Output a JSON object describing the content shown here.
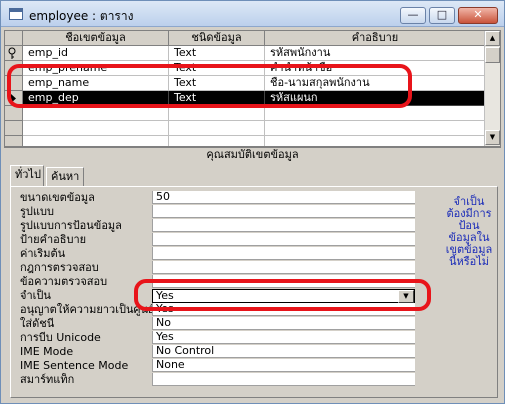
{
  "window": {
    "title": "employee : ตาราง",
    "minimize": "—",
    "maximize": "□",
    "close": "✕"
  },
  "grid": {
    "headers": [
      "ชื่อเขตข้อมูล",
      "ชนิดข้อมูล",
      "คำอธิบาย"
    ],
    "rows": [
      {
        "name": "emp_id",
        "type": "Text",
        "desc": "รหัสพนักงาน"
      },
      {
        "name": "emp_prename",
        "type": "Text",
        "desc": "คำนำหน้าชื่อ"
      },
      {
        "name": "emp_name",
        "type": "Text",
        "desc": "ชื่อ-นามสกุลพนักงาน"
      },
      {
        "name": "emp_dep",
        "type": "Text",
        "desc": "รหัสแผนก"
      }
    ]
  },
  "properties": {
    "title": "คุณสมบัติเขตข้อมูล",
    "tabs": [
      "ทั่วไป",
      "ค้นหา"
    ],
    "rows": [
      {
        "label": "ขนาดเขตข้อมูล",
        "value": "50"
      },
      {
        "label": "รูปแบบ",
        "value": ""
      },
      {
        "label": "รูปแบบการป้อนข้อมูล",
        "value": ""
      },
      {
        "label": "ป้ายคำอธิบาย",
        "value": ""
      },
      {
        "label": "ค่าเริ่มต้น",
        "value": ""
      },
      {
        "label": "กฎการตรวจสอบ",
        "value": ""
      },
      {
        "label": "ข้อความตรวจสอบ",
        "value": ""
      },
      {
        "label": "จำเป็น",
        "value": "Yes"
      },
      {
        "label": "อนุญาตให้ความยาวเป็นศูนย์",
        "value": "Yes"
      },
      {
        "label": "ใส่ดัชนี",
        "value": "No"
      },
      {
        "label": "การบีบ Unicode",
        "value": "Yes"
      },
      {
        "label": "IME Mode",
        "value": "No Control"
      },
      {
        "label": "IME Sentence Mode",
        "value": "None"
      },
      {
        "label": "สมาร์ทแท็ก",
        "value": ""
      }
    ],
    "help_text": "จำเป็นต้องมีการป้อนข้อมูลในเขตข้อมูลนี้หรือไม่"
  },
  "colors": {
    "annotation": "#e8141a",
    "help_text": "#1a2bb8"
  }
}
